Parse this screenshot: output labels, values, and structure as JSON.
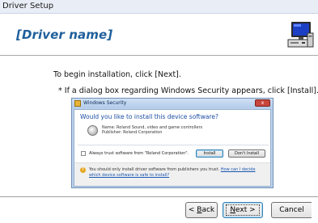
{
  "window": {
    "title": "Driver Setup"
  },
  "header": {
    "title": "[Driver name]",
    "icon": "computer-icon"
  },
  "content": {
    "instruction": "To begin installation, click [Next].",
    "note": "* If a dialog box regarding Windows Security appears, click [Install]."
  },
  "security_dialog": {
    "title": "Windows Security",
    "close_label": "x",
    "question": "Would you like to install this device software?",
    "device_name": "Name: Roland Sound, video and game controllers",
    "publisher": "Publisher: Roland Corporation",
    "always_trust": "Always trust software from \"Roland Corporation\".",
    "install_label": "Install",
    "dont_install_label": "Don't Install",
    "warning_text": "You should only install driver software from publishers you trust.",
    "warning_link_1": "How can I decide",
    "warning_link_2": "which device software is safe to install?"
  },
  "buttons": {
    "back": {
      "prefix": "< ",
      "accel": "B",
      "rest": "ack"
    },
    "next": {
      "accel": "N",
      "rest": "ext >"
    },
    "cancel": "Cancel"
  },
  "colors": {
    "header_title": "#1f5f9c",
    "dialog_question": "#1d4fa3",
    "link": "#1a56b0"
  }
}
